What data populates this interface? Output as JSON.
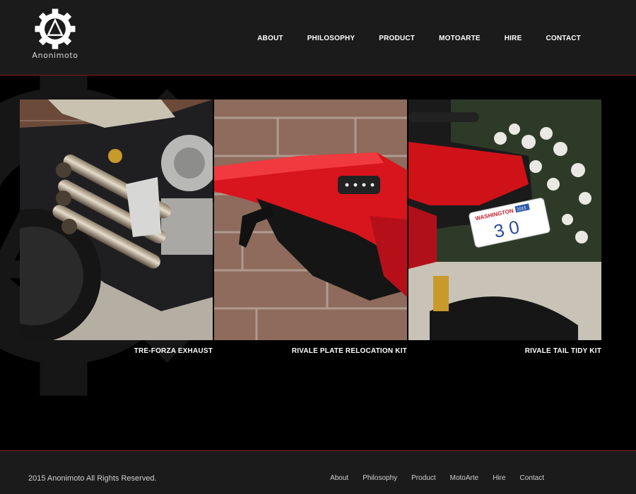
{
  "brand": {
    "name": "Anonimoto",
    "accent_color": "#8a1a1a",
    "header_color": "#1b1b1c"
  },
  "nav": {
    "items": [
      {
        "label": "ABOUT"
      },
      {
        "label": "PHILOSOPHY"
      },
      {
        "label": "PRODUCT"
      },
      {
        "label": "MOTOARTE"
      },
      {
        "label": "HIRE"
      },
      {
        "label": "CONTACT"
      }
    ]
  },
  "products": [
    {
      "title": "TRE-FORZA EXHAUST",
      "image": "exhaust-photo"
    },
    {
      "title": "RIVALE PLATE RELOCATION KIT",
      "image": "tail-light-photo"
    },
    {
      "title": "RIVALE TAIL TIDY KIT",
      "image": "license-plate-photo"
    }
  ],
  "plate": {
    "state": "WASHINGTON",
    "year": "2015",
    "number": "3  0"
  },
  "footer": {
    "copyright": "2015 Anonimoto All Rights Reserved.",
    "items": [
      {
        "label": "About"
      },
      {
        "label": "Philosophy"
      },
      {
        "label": "Product"
      },
      {
        "label": "MotoArte"
      },
      {
        "label": "Hire"
      },
      {
        "label": "Contact"
      }
    ]
  }
}
